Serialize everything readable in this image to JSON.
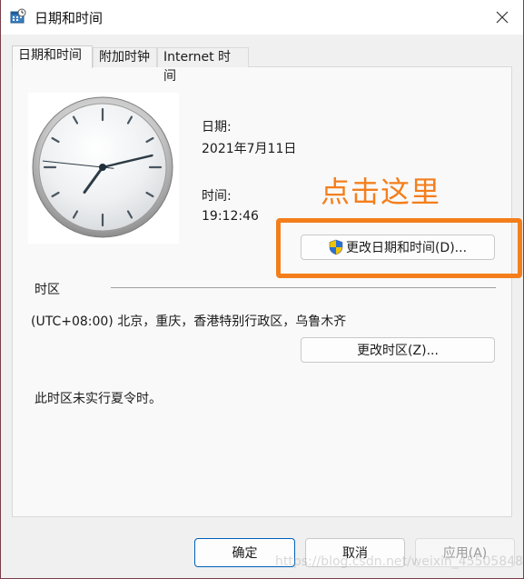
{
  "window": {
    "title": "日期和时间",
    "title_icon": "date-time-control-panel-icon"
  },
  "tabs": [
    {
      "label": "日期和时间",
      "active": true
    },
    {
      "label": "附加时钟",
      "active": false
    },
    {
      "label": "Internet 时间",
      "active": false
    }
  ],
  "clock": {
    "hour": 19,
    "minute": 12,
    "second": 46
  },
  "date": {
    "label": "日期:",
    "value": "2021年7月11日"
  },
  "time": {
    "label": "时间:",
    "value": "19:12:46"
  },
  "change_datetime_button": {
    "label": "更改日期和时间(D)...",
    "icon": "uac-shield-icon"
  },
  "annotation": {
    "text": "点击这里",
    "color": "#f47e1c"
  },
  "timezone": {
    "header": "时区",
    "value": "(UTC+08:00) 北京，重庆，香港特别行政区，乌鲁木齐",
    "change_button": "更改时区(Z)...",
    "dst_note": "此时区未实行夏令时。"
  },
  "footer": {
    "ok": "确定",
    "cancel": "取消",
    "apply": "应用(A)"
  },
  "watermark": "https://blog.csdn.net/weixin_45505848",
  "colors": {
    "accent": "#005fb8",
    "annotation": "#f47e1c",
    "border": "#7a3d48"
  }
}
